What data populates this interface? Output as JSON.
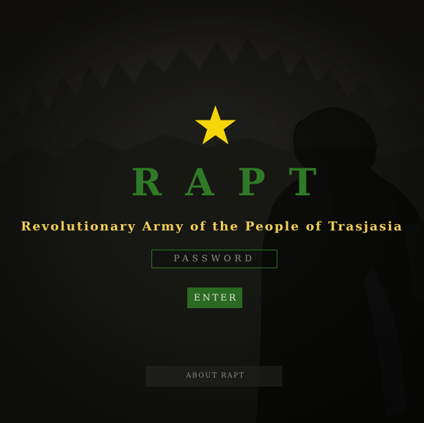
{
  "logo": {
    "star_icon": "star-icon",
    "star_color": "#f5d60a",
    "title": "RAPT",
    "title_color": "#2f7a26"
  },
  "subtitle": {
    "text": "Revolutionary Army of the People of Trasjasia",
    "color": "#f2cf57"
  },
  "login": {
    "password_placeholder": "PASSWORD",
    "password_value": "",
    "enter_label": "ENTER",
    "accent_color": "#2a6a22"
  },
  "footer": {
    "about_label": "ABOUT RAPT"
  }
}
